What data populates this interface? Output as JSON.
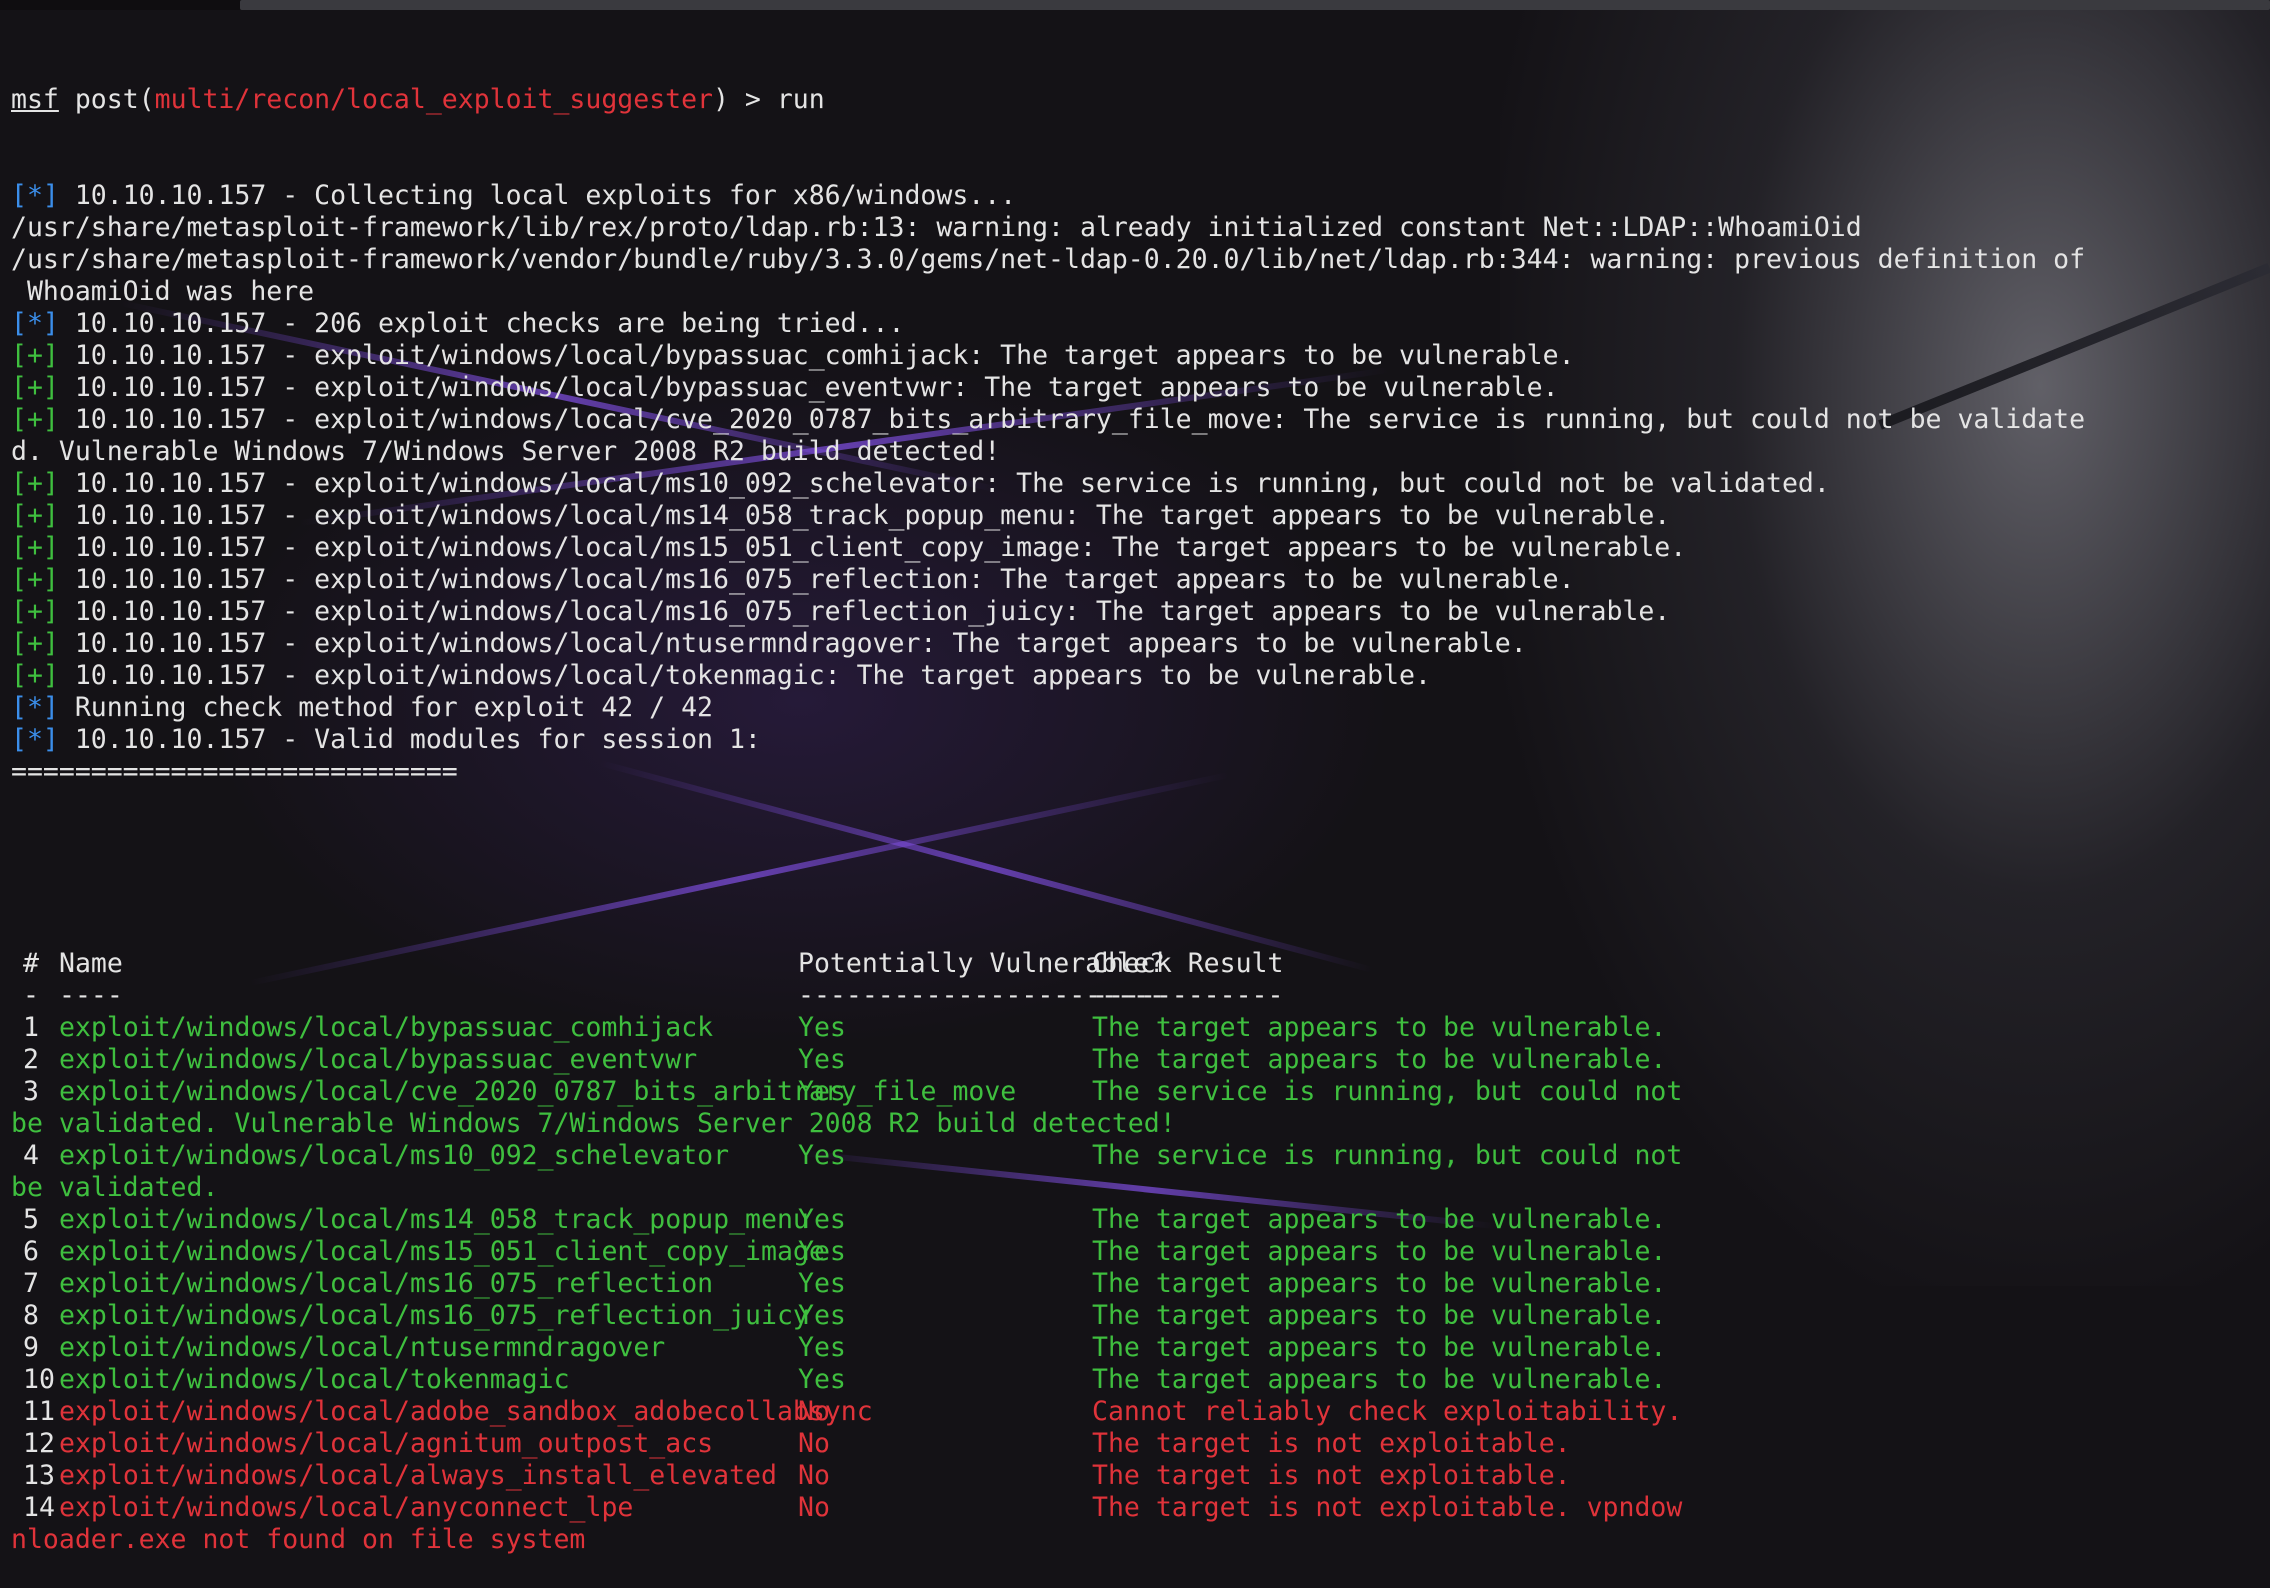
{
  "prompt": {
    "msf": "msf",
    "post": " post(",
    "module": "multi/recon/local_exploit_suggester",
    "close": ") > ",
    "command": "run"
  },
  "output": [
    {
      "tag": "[*]",
      "kind": "info",
      "text": " 10.10.10.157 - Collecting local exploits for x86/windows..."
    },
    {
      "tag": "",
      "kind": "plain",
      "text": "/usr/share/metasploit-framework/lib/rex/proto/ldap.rb:13: warning: already initialized constant Net::LDAP::WhoamiOid"
    },
    {
      "tag": "",
      "kind": "plain",
      "text": "/usr/share/metasploit-framework/vendor/bundle/ruby/3.3.0/gems/net-ldap-0.20.0/lib/net/ldap.rb:344: warning: previous definition of"
    },
    {
      "tag": "",
      "kind": "plain",
      "text": " WhoamiOid was here"
    },
    {
      "tag": "[*]",
      "kind": "info",
      "text": " 10.10.10.157 - 206 exploit checks are being tried..."
    },
    {
      "tag": "[+]",
      "kind": "good",
      "text": " 10.10.10.157 - exploit/windows/local/bypassuac_comhijack: The target appears to be vulnerable."
    },
    {
      "tag": "[+]",
      "kind": "good",
      "text": " 10.10.10.157 - exploit/windows/local/bypassuac_eventvwr: The target appears to be vulnerable."
    },
    {
      "tag": "[+]",
      "kind": "good",
      "text": " 10.10.10.157 - exploit/windows/local/cve_2020_0787_bits_arbitrary_file_move: The service is running, but could not be validate"
    },
    {
      "tag": "",
      "kind": "plain",
      "text": "d. Vulnerable Windows 7/Windows Server 2008 R2 build detected!"
    },
    {
      "tag": "[+]",
      "kind": "good",
      "text": " 10.10.10.157 - exploit/windows/local/ms10_092_schelevator: The service is running, but could not be validated."
    },
    {
      "tag": "[+]",
      "kind": "good",
      "text": " 10.10.10.157 - exploit/windows/local/ms14_058_track_popup_menu: The target appears to be vulnerable."
    },
    {
      "tag": "[+]",
      "kind": "good",
      "text": " 10.10.10.157 - exploit/windows/local/ms15_051_client_copy_image: The target appears to be vulnerable."
    },
    {
      "tag": "[+]",
      "kind": "good",
      "text": " 10.10.10.157 - exploit/windows/local/ms16_075_reflection: The target appears to be vulnerable."
    },
    {
      "tag": "[+]",
      "kind": "good",
      "text": " 10.10.10.157 - exploit/windows/local/ms16_075_reflection_juicy: The target appears to be vulnerable."
    },
    {
      "tag": "[+]",
      "kind": "good",
      "text": " 10.10.10.157 - exploit/windows/local/ntusermndragover: The target appears to be vulnerable."
    },
    {
      "tag": "[+]",
      "kind": "good",
      "text": " 10.10.10.157 - exploit/windows/local/tokenmagic: The target appears to be vulnerable."
    },
    {
      "tag": "[*]",
      "kind": "info",
      "text": " Running check method for exploit 42 / 42"
    },
    {
      "tag": "[*]",
      "kind": "info",
      "text": " 10.10.10.157 - Valid modules for session 1:"
    },
    {
      "tag": "",
      "kind": "plain",
      "text": "============================"
    }
  ],
  "table": {
    "headers": {
      "num": "#",
      "name": "Name",
      "vuln": "Potentially Vulnerable?",
      "result": "Check Result"
    },
    "dividers": {
      "num": "-",
      "name": "----",
      "vuln": "-----------------------",
      "result": "------------"
    },
    "rows": [
      {
        "num": "1",
        "name": "exploit/windows/local/bypassuac_comhijack",
        "vuln": "Yes",
        "result": "The target appears to be vulnerable.",
        "wrap": "",
        "status": "yes"
      },
      {
        "num": "2",
        "name": "exploit/windows/local/bypassuac_eventvwr",
        "vuln": "Yes",
        "result": "The target appears to be vulnerable.",
        "wrap": "",
        "status": "yes"
      },
      {
        "num": "3",
        "name": "exploit/windows/local/cve_2020_0787_bits_arbitrary_file_move",
        "vuln": "Yes",
        "result": "The service is running, but could not",
        "wrap": "be validated. Vulnerable Windows 7/Windows Server 2008 R2 build detected!",
        "status": "yes"
      },
      {
        "num": "4",
        "name": "exploit/windows/local/ms10_092_schelevator",
        "vuln": "Yes",
        "result": "The service is running, but could not",
        "wrap": "be validated.",
        "status": "yes"
      },
      {
        "num": "5",
        "name": "exploit/windows/local/ms14_058_track_popup_menu",
        "vuln": "Yes",
        "result": "The target appears to be vulnerable.",
        "wrap": "",
        "status": "yes"
      },
      {
        "num": "6",
        "name": "exploit/windows/local/ms15_051_client_copy_image",
        "vuln": "Yes",
        "result": "The target appears to be vulnerable.",
        "wrap": "",
        "status": "yes"
      },
      {
        "num": "7",
        "name": "exploit/windows/local/ms16_075_reflection",
        "vuln": "Yes",
        "result": "The target appears to be vulnerable.",
        "wrap": "",
        "status": "yes"
      },
      {
        "num": "8",
        "name": "exploit/windows/local/ms16_075_reflection_juicy",
        "vuln": "Yes",
        "result": "The target appears to be vulnerable.",
        "wrap": "",
        "status": "yes"
      },
      {
        "num": "9",
        "name": "exploit/windows/local/ntusermndragover",
        "vuln": "Yes",
        "result": "The target appears to be vulnerable.",
        "wrap": "",
        "status": "yes"
      },
      {
        "num": "10",
        "name": "exploit/windows/local/tokenmagic",
        "vuln": "Yes",
        "result": "The target appears to be vulnerable.",
        "wrap": "",
        "status": "yes"
      },
      {
        "num": "11",
        "name": "exploit/windows/local/adobe_sandbox_adobecollabsync",
        "vuln": "No",
        "result": "Cannot reliably check exploitability.",
        "wrap": "",
        "status": "no"
      },
      {
        "num": "12",
        "name": "exploit/windows/local/agnitum_outpost_acs",
        "vuln": "No",
        "result": "The target is not exploitable.",
        "wrap": "",
        "status": "no"
      },
      {
        "num": "13",
        "name": "exploit/windows/local/always_install_elevated",
        "vuln": "No",
        "result": "The target is not exploitable.",
        "wrap": "",
        "status": "no"
      },
      {
        "num": "14",
        "name": "exploit/windows/local/anyconnect_lpe",
        "vuln": "No",
        "result": "The target is not exploitable. vpndow",
        "wrap": "nloader.exe not found on file system",
        "status": "no"
      }
    ]
  },
  "colors": {
    "info": "#3b8eea",
    "good": "#3fbf3f",
    "bad": "#e0333a",
    "text": "#e4e4e4",
    "background": "#141216"
  }
}
